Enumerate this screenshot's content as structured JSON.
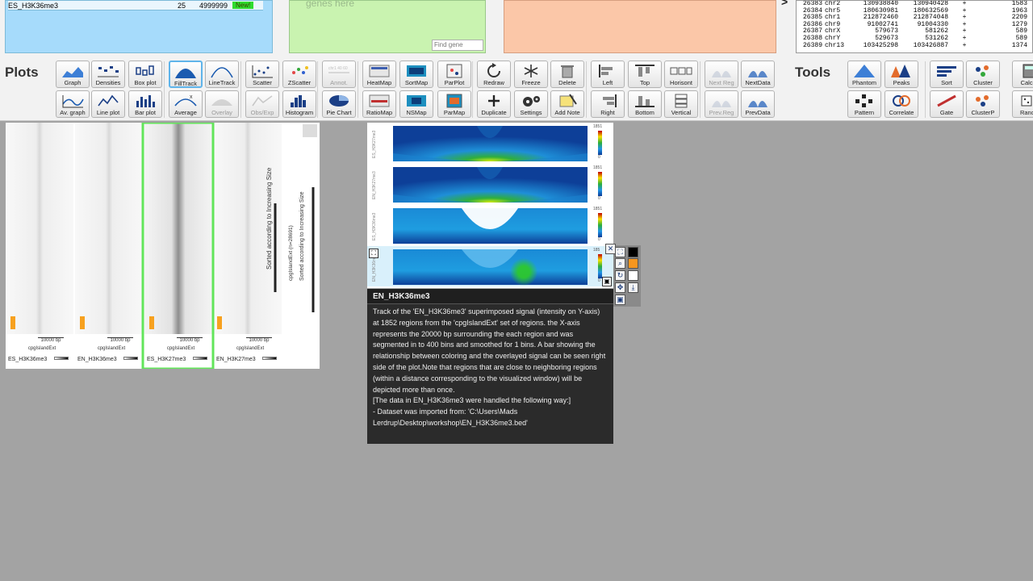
{
  "top": {
    "dataset_row": {
      "name": "ES_H3K36me3",
      "count": "25",
      "max": "4999999",
      "badge": "New!"
    },
    "gene_panel": {
      "hint": "genes here",
      "find_placeholder": "Find gene"
    },
    "arrow": ">",
    "region_rows": [
      {
        "id": "26383",
        "chr": "chr2",
        "start": "130938840",
        "end": "130940428",
        "strand": "+",
        "len": "1583"
      },
      {
        "id": "26384",
        "chr": "chr5",
        "start": "180630981",
        "end": "180632569",
        "strand": "+",
        "len": "1963"
      },
      {
        "id": "26385",
        "chr": "chr1",
        "start": "212872460",
        "end": "212874048",
        "strand": "+",
        "len": "2209"
      },
      {
        "id": "26386",
        "chr": "chr9",
        "start": "91002741",
        "end": "91004330",
        "strand": "+",
        "len": "1279"
      },
      {
        "id": "26387",
        "chr": "chrX",
        "start": "579673",
        "end": "581262",
        "strand": "+",
        "len": "589"
      },
      {
        "id": "26388",
        "chr": "chrY",
        "start": "529673",
        "end": "531262",
        "strand": "+",
        "len": "589"
      },
      {
        "id": "26389",
        "chr": "chr13",
        "start": "103425298",
        "end": "103426887",
        "strand": "+",
        "len": "1374"
      }
    ]
  },
  "toolbar": {
    "plots_label": "Plots",
    "tools_label": "Tools",
    "plot_buttons_row1": [
      {
        "label": "Graph",
        "icon": "area-graph-icon"
      },
      {
        "label": "Densities",
        "icon": "densities-icon"
      },
      {
        "label": "Box plot",
        "icon": "box-plot-icon"
      },
      {
        "label": "FillTrack",
        "icon": "fill-track-icon"
      },
      {
        "label": "LineTrack",
        "icon": "line-track-icon"
      },
      {
        "label": "Scatter",
        "icon": "scatter-icon"
      },
      {
        "label": "ZScatter",
        "icon": "zscatter-icon"
      },
      {
        "label": "Annot.",
        "icon": "annotation-icon"
      },
      {
        "label": "HeatMap",
        "icon": "heatmap-icon"
      },
      {
        "label": "SortMap",
        "icon": "sortmap-icon"
      },
      {
        "label": "ParPlot",
        "icon": "parplot-icon"
      },
      {
        "label": "Redraw",
        "icon": "redraw-icon"
      },
      {
        "label": "Freeze",
        "icon": "freeze-icon"
      },
      {
        "label": "Delete",
        "icon": "trash-icon"
      },
      {
        "label": "Left",
        "icon": "align-left-icon"
      },
      {
        "label": "Top",
        "icon": "align-top-icon"
      },
      {
        "label": "Horisont",
        "icon": "horizontal-icon"
      },
      {
        "label": "Next Reg",
        "icon": "next-region-icon"
      },
      {
        "label": "NextData",
        "icon": "next-data-icon"
      }
    ],
    "plot_buttons_row2": [
      {
        "label": "Av. graph",
        "icon": "average-graph-icon"
      },
      {
        "label": "Line plot",
        "icon": "line-plot-icon"
      },
      {
        "label": "Bar plot",
        "icon": "bar-plot-icon"
      },
      {
        "label": "Average",
        "icon": "average-icon"
      },
      {
        "label": "Overlay",
        "icon": "overlay-icon"
      },
      {
        "label": "Obs/Exp",
        "icon": "obs-exp-icon"
      },
      {
        "label": "Histogram",
        "icon": "histogram-icon"
      },
      {
        "label": "Pie Chart",
        "icon": "pie-chart-icon"
      },
      {
        "label": "RatioMap",
        "icon": "ratiomap-icon"
      },
      {
        "label": "NSMap",
        "icon": "nsmap-icon"
      },
      {
        "label": "ParMap",
        "icon": "parmap-icon"
      },
      {
        "label": "Duplicate",
        "icon": "plus-icon"
      },
      {
        "label": "Settings",
        "icon": "gears-icon"
      },
      {
        "label": "Add Note",
        "icon": "add-note-icon"
      },
      {
        "label": "Right",
        "icon": "align-right-icon"
      },
      {
        "label": "Bottom",
        "icon": "align-bottom-icon"
      },
      {
        "label": "Vertical",
        "icon": "vertical-icon"
      },
      {
        "label": "Prev.Reg",
        "icon": "prev-region-icon"
      },
      {
        "label": "PrevData",
        "icon": "prev-data-icon"
      }
    ],
    "annot_ticks": "chr1  40  60\n200p",
    "tool_buttons_row1": [
      {
        "label": "Phantom",
        "icon": "phantom-icon"
      },
      {
        "label": "Peaks",
        "icon": "peaks-icon"
      },
      {
        "label": "Sort",
        "icon": "sort-icon"
      },
      {
        "label": "Cluster",
        "icon": "cluster-icon"
      },
      {
        "label": "Calcul",
        "icon": "calculator-icon"
      }
    ],
    "tool_buttons_row2": [
      {
        "label": "Pattern",
        "icon": "pattern-icon"
      },
      {
        "label": "Correlate",
        "icon": "correlate-icon"
      },
      {
        "label": "Gate",
        "icon": "gate-icon"
      },
      {
        "label": "ClusterP",
        "icon": "clusterp-icon"
      },
      {
        "label": "Rando",
        "icon": "random-icon"
      }
    ]
  },
  "heatmap": {
    "columns": [
      {
        "region": "cpgIslandExt",
        "name": "ES_H3K36me3",
        "scale": "10000 bp"
      },
      {
        "region": "cpgIslandExt",
        "name": "EN_H3K36me3",
        "scale": "10000 bp"
      },
      {
        "region": "cpgIslandExt",
        "name": "ES_H3K27me3",
        "scale": "10000 bp"
      },
      {
        "region": "cpgIslandExt",
        "name": "EN_H3K27me3",
        "scale": "10000 bp"
      }
    ],
    "sort_label_1": "Sorted according to Increasing Size",
    "sort_label_2": "Sorted according to Increasing Size",
    "region_count_label": "cpgIslandExt (n=28691)"
  },
  "profile_tracks": [
    {
      "name": "ES_H3K27me3",
      "scale_max": "1851",
      "scale_min": "0"
    },
    {
      "name": "EN_H3K27me3",
      "scale_max": "1851",
      "scale_min": "0"
    },
    {
      "name": "ES_H3K36me3",
      "scale_max": "1851",
      "scale_min": "0"
    },
    {
      "name": "EN_H3K36me3",
      "scale_max": "185",
      "scale_min": "0"
    }
  ],
  "tooltip": {
    "title": "EN_H3K36me3",
    "body": "Track of the 'EN_H3K36me3' superimposed signal (intensity on Y-axis) at 1852 regions from the 'cpgIslandExt' set of regions. the X-axis represents the 20000 bp surrounding the each region and was segmented in to 400 bins and smoothed for 1 bins. A bar showing the relationship between coloring and the overlayed signal can be seen right side of the plot.Note that regions that are close to neighboring regions (within a distance corresponding to the visualized window) will be depicted more than once.\n[The data in EN_H3K36me3 were handled the following way:]\n              - Dataset was imported from: 'C:\\Users\\Mads Lerdrup\\Desktop\\workshop\\EN_H3K36me3.bed'"
  },
  "colors": {
    "panel_blue": "#a6dbfb",
    "panel_green": "#c9f3b0",
    "panel_orange": "#fbc7a8",
    "highlight": "#62e55a",
    "tooltip_bg": "#2b2b2b",
    "workspace": "#a3a3a3"
  }
}
